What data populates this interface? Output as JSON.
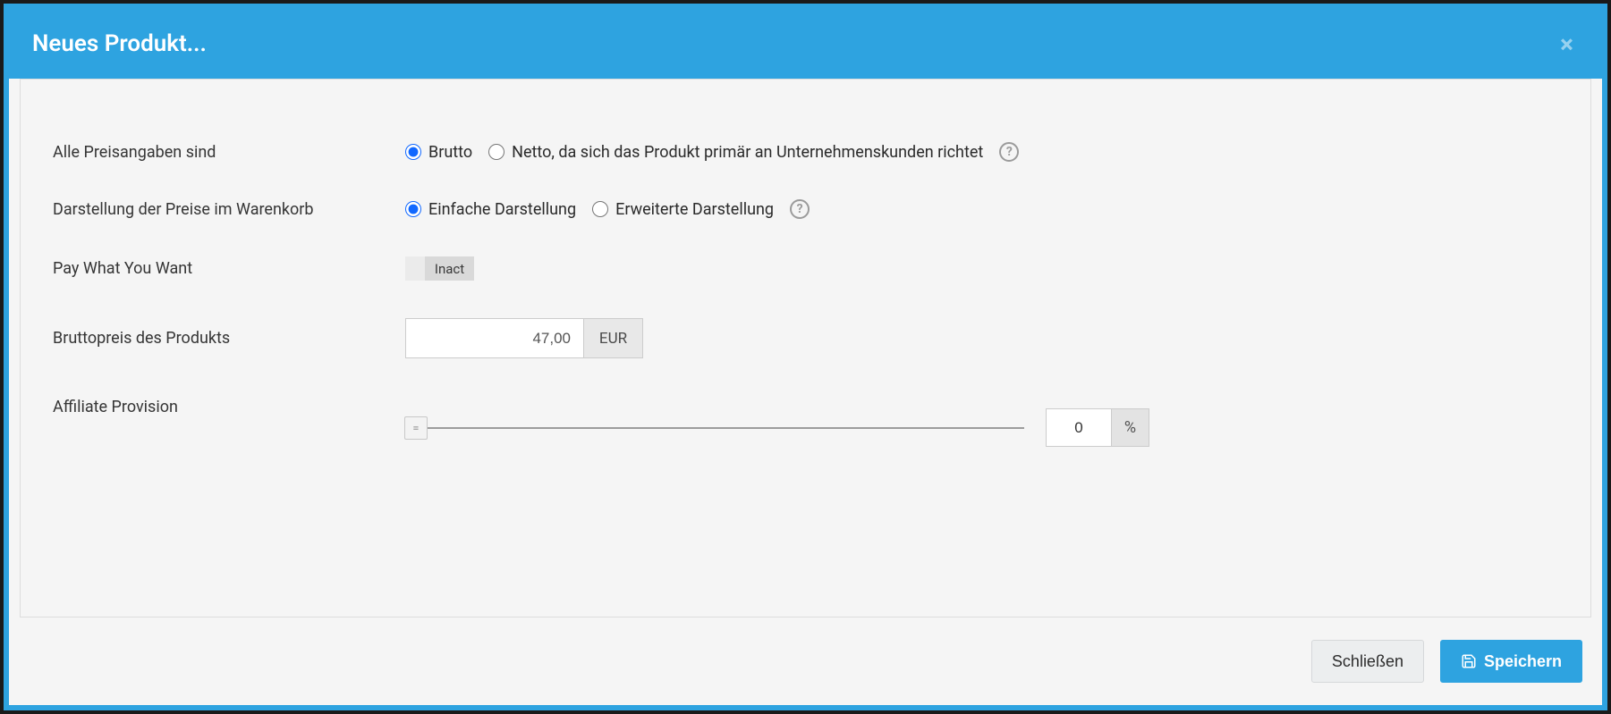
{
  "modal": {
    "title": "Neues Produkt...",
    "close_glyph": "×"
  },
  "form": {
    "price_type": {
      "label": "Alle Preisangaben sind",
      "options": {
        "brutto": "Brutto",
        "netto": "Netto, da sich das Produkt primär an Unternehmenskunden richtet"
      },
      "help": "?"
    },
    "cart_display": {
      "label": "Darstellung der Preise im Warenkorb",
      "options": {
        "simple": "Einfache Darstellung",
        "extended": "Erweiterte Darstellung"
      },
      "help": "?"
    },
    "pwyw": {
      "label": "Pay What You Want",
      "toggle_label": "Inact"
    },
    "gross_price": {
      "label": "Bruttopreis des Produkts",
      "value": "47,00",
      "currency": "EUR"
    },
    "affiliate": {
      "label": "Affiliate Provision",
      "value": "0",
      "unit": "%"
    }
  },
  "footer": {
    "close": "Schließen",
    "save": "Speichern"
  }
}
